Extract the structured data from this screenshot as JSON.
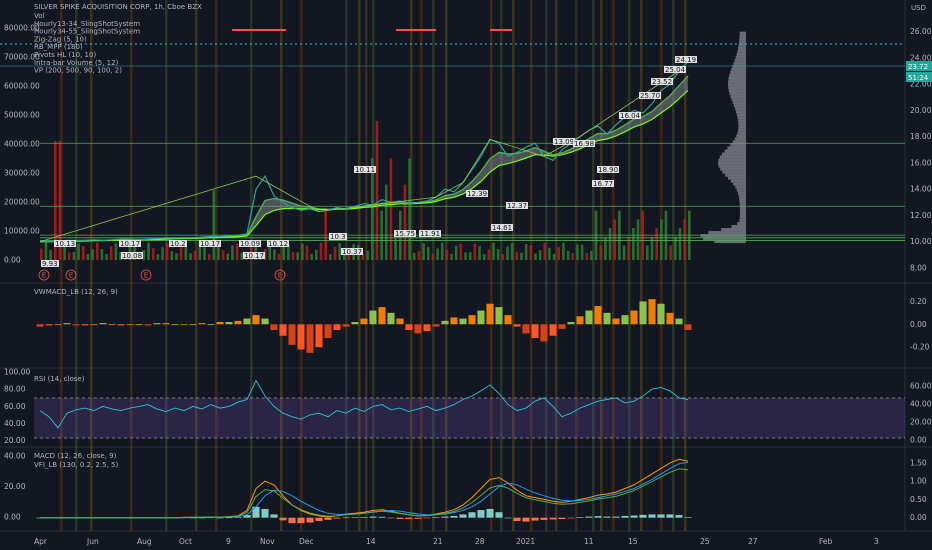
{
  "header": {
    "title": "SILVER SPIKE ACQUISITION CORP, 1h, Cboe BZX",
    "currency": "USD"
  },
  "main_pane": {
    "indicators": [
      "Vol",
      "Hourly13-34_SlingShotSystem",
      "Hourly34-55_SlingShotSystem",
      "Zig-Zag (5, 10)",
      "RB_MPP (180)",
      "Pivots HL (10, 10)",
      "Intra-bar Volume (5, 12)",
      "VP (200, 500, 90, 100, 2)"
    ],
    "last_price_tag": "23.72",
    "countdown_tag": "51:24"
  },
  "vwmacd_pane": {
    "title": "VWMACD_LB (12, 26, 9)"
  },
  "rsi_pane": {
    "title": "RSI (14, close)"
  },
  "macd_pane": {
    "title": "MACD (12, 26, close, 9)",
    "subtitle": "VFI_LB (130, 0.2, 2.5, 5)"
  },
  "time_axis": {
    "labels": [
      "Apr",
      "Jun",
      "Aug",
      "Oct",
      "9",
      "Nov",
      "Dec",
      "14",
      "21",
      "28",
      "2021",
      "11",
      "15",
      "25",
      "27",
      "Feb",
      "3"
    ]
  },
  "earnings_marker": "E",
  "pivot_labels": [
    "9.93",
    "10.13",
    "10.17",
    "10.08",
    "10.2",
    "10.17",
    "10.09",
    "10.17",
    "10.12",
    "10.3",
    "10.37",
    "10.11",
    "15.75",
    "11.91",
    "12.39",
    "14.61",
    "12.37",
    "13.09",
    "16.98",
    "16.77",
    "16.04",
    "25.70",
    "23.52",
    "25.04",
    "24.19",
    "18.90"
  ],
  "chart_data": [
    {
      "type": "line",
      "name": "price",
      "right_axis_ticks": [
        "26.00",
        "24.00",
        "22.00",
        "20.00",
        "18.00",
        "16.00",
        "14.00",
        "12.00",
        "10.00",
        "8.00"
      ],
      "ylim": [
        8,
        26.5
      ],
      "left_axis_ticks": [
        "80000.00",
        "70000.00",
        "60000.00",
        "50000.00",
        "40000.00",
        "30000.00",
        "20000.00",
        "10000.00",
        "0.00"
      ],
      "close": [
        10.0,
        10.0,
        10.05,
        10.1,
        10.1,
        10.1,
        10.15,
        10.1,
        10.15,
        10.2,
        10.2,
        10.15,
        10.2,
        10.25,
        10.3,
        10.3,
        10.3,
        10.3,
        10.35,
        10.4,
        10.4,
        10.45,
        10.5,
        10.6,
        14.0,
        15.0,
        13.5,
        13.0,
        12.6,
        12.4,
        12.5,
        12.3,
        12.4,
        12.6,
        12.5,
        12.7,
        12.9,
        12.8,
        13.2,
        13.0,
        13.1,
        12.9,
        13.0,
        13.1,
        13.4,
        14.0,
        13.8,
        14.5,
        15.5,
        16.5,
        17.8,
        17.5,
        16.5,
        16.8,
        17.2,
        17.5,
        16.5,
        16.2,
        17.0,
        17.5,
        18.0,
        18.5,
        18.8,
        18.2,
        18.9,
        19.5,
        20.0,
        19.8,
        20.5,
        21.5,
        22.0,
        23.0,
        23.72
      ]
    },
    {
      "type": "bar",
      "name": "VWMACD",
      "right_axis_ticks": [
        "0.20",
        "0.00",
        "-0.20"
      ],
      "ylim": [
        -0.33,
        0.3
      ],
      "values": [
        -0.02,
        -0.01,
        0,
        0.01,
        -0.01,
        -0.01,
        0,
        0.01,
        0.0,
        -0.01,
        0,
        0,
        -0.01,
        0.01,
        0.01,
        0,
        0,
        0,
        0.01,
        0,
        0.02,
        0.02,
        0.03,
        0.05,
        0.08,
        0.05,
        -0.05,
        -0.1,
        -0.18,
        -0.22,
        -0.25,
        -0.2,
        -0.12,
        -0.05,
        -0.02,
        0.02,
        0.05,
        0.12,
        0.15,
        0.1,
        0.05,
        -0.05,
        -0.08,
        -0.06,
        -0.02,
        0.03,
        0.06,
        0.05,
        0.08,
        0.12,
        0.18,
        0.15,
        0.08,
        -0.02,
        -0.08,
        -0.12,
        -0.15,
        -0.1,
        -0.04,
        0.02,
        0.07,
        0.12,
        0.16,
        0.1,
        0.05,
        0.08,
        0.12,
        0.2,
        0.22,
        0.18,
        0.1,
        0.05,
        -0.05
      ]
    },
    {
      "type": "line",
      "name": "RSI",
      "left_axis_ticks": [
        "100.00",
        "80.00",
        "60.00",
        "40.00",
        "20.00"
      ],
      "right_axis_ticks": [
        "60.00",
        "40.00",
        "20.00",
        "0.00"
      ],
      "ylim": [
        15,
        100
      ],
      "values": [
        55,
        48,
        35,
        52,
        56,
        58,
        55,
        60,
        57,
        55,
        58,
        60,
        62,
        57,
        54,
        58,
        55,
        60,
        57,
        62,
        58,
        60,
        65,
        68,
        90,
        72,
        60,
        52,
        48,
        45,
        50,
        52,
        48,
        55,
        52,
        58,
        54,
        60,
        62,
        56,
        58,
        54,
        57,
        60,
        55,
        58,
        62,
        68,
        72,
        78,
        85,
        75,
        62,
        55,
        58,
        66,
        70,
        60,
        48,
        52,
        58,
        62,
        66,
        68,
        70,
        64,
        66,
        72,
        80,
        82,
        78,
        70,
        68
      ]
    },
    {
      "type": "line",
      "name": "MACD",
      "left_axis_ticks": [
        "40.00",
        "20.00",
        "0.00"
      ],
      "right_axis_ticks": [
        "1.50",
        "1.00",
        "0.50",
        "0.00"
      ],
      "ylim": [
        -0.2,
        1.8
      ],
      "macd": [
        0,
        0,
        0,
        0,
        0,
        0,
        0,
        0,
        0,
        0,
        0,
        0,
        0,
        0,
        0,
        0,
        0.01,
        0.01,
        0.01,
        0.02,
        0.02,
        0.03,
        0.05,
        0.2,
        0.8,
        1.0,
        0.9,
        0.6,
        0.35,
        0.2,
        0.1,
        0.05,
        0.02,
        0.05,
        0.1,
        0.12,
        0.15,
        0.2,
        0.22,
        0.18,
        0.12,
        0.08,
        0.05,
        0.06,
        0.1,
        0.15,
        0.22,
        0.35,
        0.55,
        0.8,
        1.05,
        1.1,
        0.95,
        0.75,
        0.6,
        0.55,
        0.5,
        0.45,
        0.42,
        0.45,
        0.5,
        0.55,
        0.62,
        0.65,
        0.7,
        0.8,
        0.9,
        1.05,
        1.2,
        1.35,
        1.5,
        1.6,
        1.55
      ],
      "signal": [
        0,
        0,
        0,
        0,
        0,
        0,
        0,
        0,
        0,
        0,
        0,
        0,
        0,
        0,
        0,
        0,
        0,
        0.01,
        0.01,
        0.01,
        0.02,
        0.02,
        0.03,
        0.08,
        0.3,
        0.6,
        0.75,
        0.72,
        0.6,
        0.45,
        0.32,
        0.2,
        0.12,
        0.09,
        0.09,
        0.1,
        0.12,
        0.15,
        0.18,
        0.2,
        0.18,
        0.14,
        0.1,
        0.08,
        0.08,
        0.1,
        0.14,
        0.2,
        0.3,
        0.45,
        0.65,
        0.85,
        0.95,
        0.9,
        0.78,
        0.68,
        0.6,
        0.53,
        0.48,
        0.46,
        0.47,
        0.5,
        0.55,
        0.6,
        0.65,
        0.72,
        0.8,
        0.92,
        1.05,
        1.2,
        1.35,
        1.48,
        1.52
      ]
    }
  ]
}
